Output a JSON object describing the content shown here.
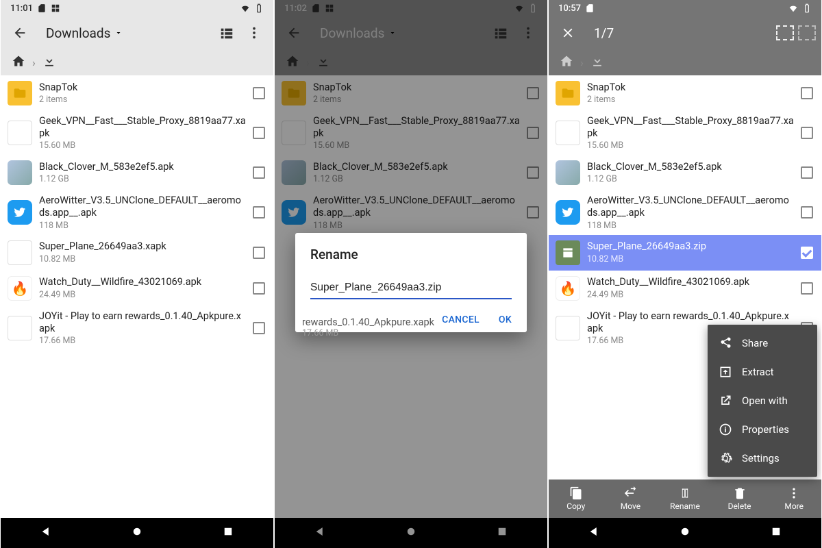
{
  "screen1": {
    "time": "11:01",
    "title": "Downloads",
    "files": [
      {
        "name": "SnapTok",
        "sub": "2 items",
        "thumb": "folder"
      },
      {
        "name": "Geek_VPN__Fast___Stable_Proxy_8819aa77.xapk",
        "sub": "15.60 MB",
        "thumb": "blank"
      },
      {
        "name": "Black_Clover_M_583e2ef5.apk",
        "sub": "1.12 GB",
        "thumb": "img"
      },
      {
        "name": "AeroWitter_V3.5_UNClone_DEFAULT__aeromods.app__.apk",
        "sub": "118 MB",
        "thumb": "blue"
      },
      {
        "name": "Super_Plane_26649aa3.xapk",
        "sub": "10.82 MB",
        "thumb": "blank"
      },
      {
        "name": "Watch_Duty__Wildfire_43021069.apk",
        "sub": "24.49 MB",
        "thumb": "fire"
      },
      {
        "name": "JOYit - Play to earn rewards_0.1.40_Apkpure.xapk",
        "sub": "17.66 MB",
        "thumb": "blank"
      }
    ]
  },
  "screen2": {
    "time": "11:02",
    "title": "Downloads",
    "dialog": {
      "title": "Rename",
      "value": "Super_Plane_26649aa3.zip",
      "cancel": "CANCEL",
      "ok": "OK"
    },
    "peek": "rewards_0.1.40_Apkpure.xapk",
    "peek_sub": "17.66 MB",
    "files": [
      {
        "name": "SnapTok",
        "sub": "2 items",
        "thumb": "folder"
      },
      {
        "name": "Geek_VPN__Fast___Stable_Proxy_8819aa77.xapk",
        "sub": "15.60 MB",
        "thumb": "blank"
      },
      {
        "name": "Black_Clover_M_583e2ef5.apk",
        "sub": "1.12 GB",
        "thumb": "img"
      },
      {
        "name": "AeroWitter_V3.5_UNClone_DEFAULT__aeromods.app__.apk",
        "sub": "118 MB",
        "thumb": "blue"
      }
    ]
  },
  "screen3": {
    "time": "10:57",
    "counter": "1/7",
    "files": [
      {
        "name": "SnapTok",
        "sub": "2 items",
        "thumb": "folder"
      },
      {
        "name": "Geek_VPN__Fast___Stable_Proxy_8819aa77.xapk",
        "sub": "15.60 MB",
        "thumb": "blank"
      },
      {
        "name": "Black_Clover_M_583e2ef5.apk",
        "sub": "1.12 GB",
        "thumb": "img"
      },
      {
        "name": "AeroWitter_V3.5_UNClone_DEFAULT__aeromods.app__.apk",
        "sub": "118 MB",
        "thumb": "blue"
      },
      {
        "name": "Super_Plane_26649aa3.zip",
        "sub": "10.82 MB",
        "thumb": "green",
        "selected": true
      },
      {
        "name": "Watch_Duty__Wildfire_43021069.apk",
        "sub": "24.49 MB",
        "thumb": "fire"
      },
      {
        "name": "JOYit - Play to earn rewards_0.1.40_Apkpure.xapk",
        "sub": "17.66 MB",
        "thumb": "blank"
      }
    ],
    "popup": {
      "share": "Share",
      "extract": "Extract",
      "open": "Open with",
      "props": "Properties",
      "settings": "Settings"
    },
    "actions": {
      "copy": "Copy",
      "move": "Move",
      "rename": "Rename",
      "delete": "Delete",
      "more": "More"
    }
  }
}
